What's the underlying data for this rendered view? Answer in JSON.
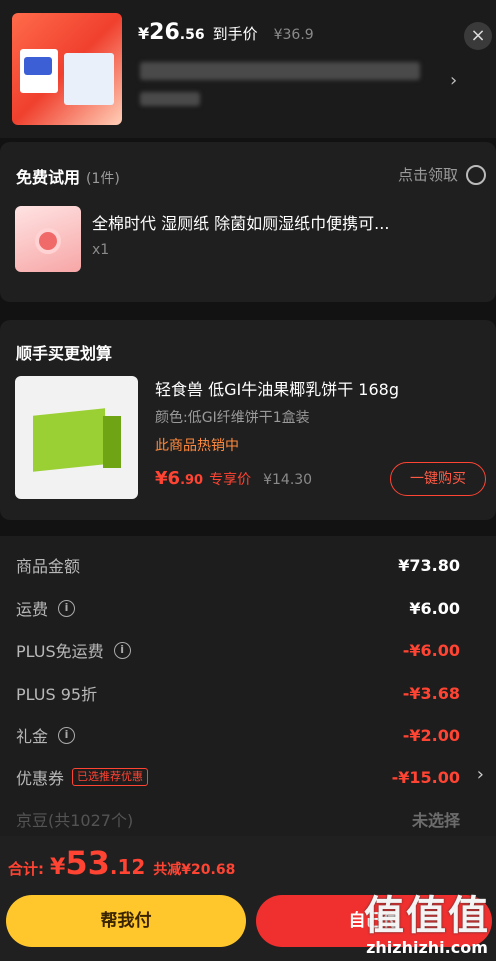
{
  "top_product": {
    "price_yen": "¥",
    "price_int": "26",
    "price_dec": ".56",
    "price_tag": "到手价",
    "orig_price": "¥36.9",
    "close_glyph": "×",
    "chevron": "›"
  },
  "free_trial": {
    "title": "免费试用",
    "count": "(1件)",
    "claim": "点击领取",
    "item_name": "全棉时代 湿厕纸 除菌如厕湿纸巾便携可...",
    "item_qty": "x1"
  },
  "bundle": {
    "title": "顺手买更划算",
    "item_name": "轻食兽 低GI牛油果椰乳饼干 168g",
    "item_spec": "颜色:低GI纤维饼干1盒装",
    "hot_label": "此商品热销中",
    "price_int": "¥6",
    "price_dec": ".90",
    "price_label": "专享价",
    "orig_price": "¥14.30",
    "buy_label": "一键购买"
  },
  "summary": {
    "rows": [
      {
        "label": "商品金额",
        "value": "¥73.80"
      },
      {
        "label": "运费",
        "value": "¥6.00"
      },
      {
        "label": "PLUS免运费",
        "value": "-¥6.00"
      },
      {
        "label": "PLUS 95折",
        "value": "-¥3.68"
      },
      {
        "label": "礼金",
        "value": "-¥2.00"
      },
      {
        "label": "优惠券",
        "value": "-¥15.00",
        "tag": "已选推荐优惠"
      },
      {
        "label": "京豆(共1027个)",
        "value": "未选择"
      }
    ],
    "info_glyph": "i",
    "chevron": "›"
  },
  "footer": {
    "total_label": "合计:",
    "total_yen": "¥",
    "total_int": "53",
    "total_dec": ".12",
    "saved": "共减¥20.68",
    "help_pay": "帮我付",
    "pay": "自己付"
  },
  "watermark": {
    "glyphs": "值值值",
    "text": "zhizhizhi.com"
  },
  "colors": {
    "accent_red": "#ff4433",
    "help_yellow": "#ffc72b",
    "pay_red": "#f02f2f"
  }
}
